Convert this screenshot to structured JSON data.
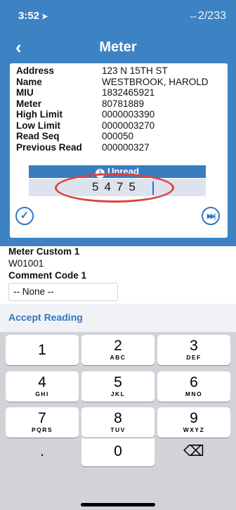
{
  "status": {
    "time": "3:52",
    "location_arrow": "➤",
    "signal": "▪▪▪",
    "right_text": "2/233"
  },
  "nav": {
    "back_label": "‹",
    "title": "Meter"
  },
  "meter_info": [
    {
      "label": "Address",
      "value": "123 N 15TH ST"
    },
    {
      "label": "Name",
      "value": "WESTBROOK, HAROLD"
    },
    {
      "label": "MIU",
      "value": "1832465921"
    },
    {
      "label": "Meter",
      "value": "80781889"
    },
    {
      "label": "High Limit",
      "value": "0000003390"
    },
    {
      "label": "Low Limit",
      "value": "0000003270"
    },
    {
      "label": "Read Seq",
      "value": "000050"
    },
    {
      "label": "Previous Read",
      "value": "000000327"
    }
  ],
  "reading": {
    "status_icon": "i",
    "status_label": "Unread",
    "value": "5475"
  },
  "actions": {
    "accept_icon": "check-circle-icon",
    "skip_icon": "skip-next-icon"
  },
  "custom": {
    "meter_custom_label": "Meter Custom 1",
    "meter_custom_value": "W01001",
    "comment_code_label": "Comment Code 1",
    "comment_code_value": "-- None --"
  },
  "accept_reading_label": "Accept Reading",
  "keypad": [
    {
      "num": "1",
      "letters": ""
    },
    {
      "num": "2",
      "letters": "ABC"
    },
    {
      "num": "3",
      "letters": "DEF"
    },
    {
      "num": "4",
      "letters": "GHI"
    },
    {
      "num": "5",
      "letters": "JKL"
    },
    {
      "num": "6",
      "letters": "MNO"
    },
    {
      "num": "7",
      "letters": "PQRS"
    },
    {
      "num": "8",
      "letters": "TUV"
    },
    {
      "num": "9",
      "letters": "WXYZ"
    },
    {
      "num": ".",
      "letters": ""
    },
    {
      "num": "0",
      "letters": ""
    },
    {
      "num": "⌫",
      "letters": ""
    }
  ],
  "colors": {
    "header": "#3d83c4",
    "accent": "#2f78c4",
    "highlight": "#d9453f"
  }
}
